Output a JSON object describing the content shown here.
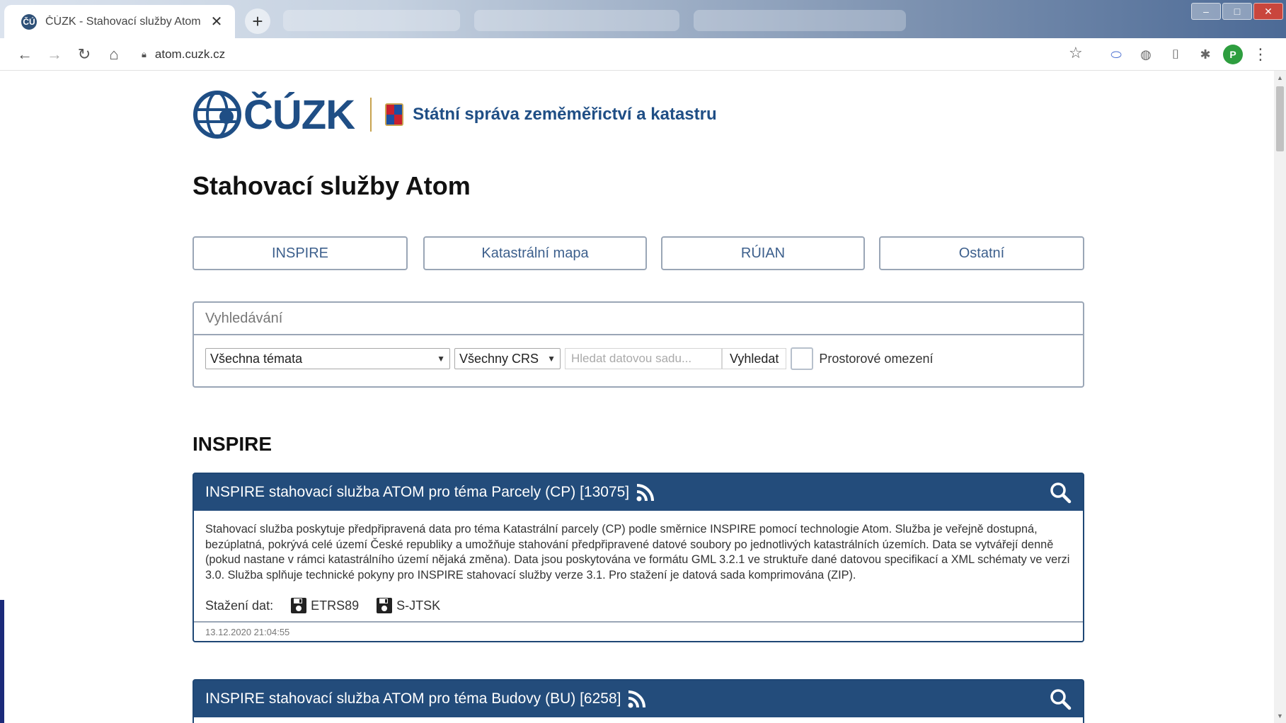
{
  "browser": {
    "tab_favicon": "ČÚ",
    "tab_title": "ČÚZK - Stahovací služby Atom",
    "tab_close": "✕",
    "new_tab": "+",
    "url": "atom.cuzk.cz",
    "profile_initial": "P",
    "window_controls": [
      "–",
      "□",
      "✕"
    ]
  },
  "header": {
    "logo_text": "ČÚZK",
    "org_name": "Státní správa zeměměřictví a katastru"
  },
  "page_title": "Stahovací služby Atom",
  "categories": [
    "INSPIRE",
    "Katastrální mapa",
    "RÚIAN",
    "Ostatní"
  ],
  "search": {
    "heading": "Vyhledávání",
    "theme_select": "Všechna témata",
    "crs_select": "Všechny CRS",
    "input_placeholder": "Hledat datovou sadu...",
    "button": "Vyhledat",
    "checkbox_label": "Prostorové omezení"
  },
  "section_title": "INSPIRE",
  "feeds": [
    {
      "title": "INSPIRE stahovací služba ATOM pro téma Parcely (CP) [13075]",
      "description": "Stahovací služba poskytuje předpřipravená data pro téma Katastrální parcely (CP) podle směrnice INSPIRE pomocí technologie Atom. Služba je veřejně dostupná, bezúplatná, pokrývá celé území České republiky a umožňuje stahování předpřipravené datové soubory po jednotlivých katastrálních územích. Data se vytvářejí denně (pokud nastane v rámci katastrálního území nějaká změna). Data jsou poskytována ve formátu GML 3.2.1 ve struktuře dané datovou specifikací a XML schématy ve verzi 3.0. Služba splňuje technické pokyny pro INSPIRE stahovací služby verze 3.1. Pro stažení je datová sada komprimována (ZIP).",
      "download_label": "Stažení dat:",
      "downloads": [
        "ETRS89",
        "S-JTSK"
      ],
      "updated": "13.12.2020 21:04:55"
    },
    {
      "title": "INSPIRE stahovací služba ATOM pro téma Budovy (BU) [6258]"
    }
  ],
  "colors": {
    "brand_blue": "#1f4e85",
    "card_header": "#234c7b",
    "border_gray": "#9aa6b6"
  }
}
